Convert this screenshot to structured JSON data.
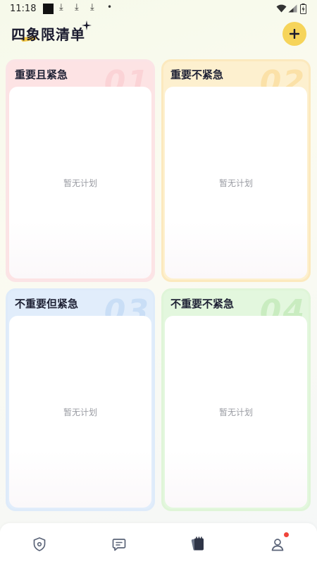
{
  "status_bar": {
    "time": "11:18",
    "download_glyph": "⤓",
    "dot": "•"
  },
  "header": {
    "title": "四象限清单",
    "add_symbol": "+"
  },
  "quadrants": [
    {
      "title": "重要且紧急",
      "number": "01",
      "empty_text": "暂无计划"
    },
    {
      "title": "重要不紧急",
      "number": "02",
      "empty_text": "暂无计划"
    },
    {
      "title": "不重要但紧急",
      "number": "03",
      "empty_text": "暂无计划"
    },
    {
      "title": "不重要不紧急",
      "number": "04",
      "empty_text": "暂无计划"
    }
  ],
  "colors": {
    "accent_yellow": "#f6d45a",
    "q1_bg": "#fde3e4",
    "q2_bg": "#fdf0cf",
    "q3_bg": "#e1edfb",
    "q4_bg": "#e3f7de",
    "notification_dot": "#f0443a"
  },
  "tab_bar": {
    "tabs": [
      "shield-icon",
      "chat-icon",
      "notes-icon",
      "profile-icon"
    ],
    "active_tab_index": 2,
    "profile_has_notification": true
  }
}
